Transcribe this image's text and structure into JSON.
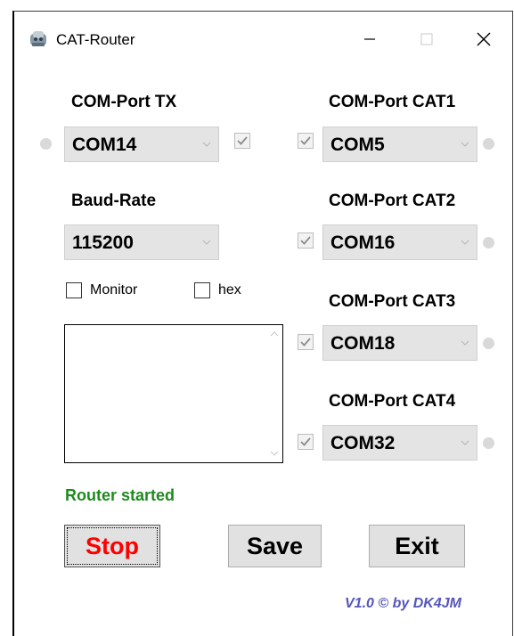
{
  "window": {
    "title": "CAT-Router",
    "controls": [
      "minimize-icon",
      "maximize-icon",
      "close-icon"
    ]
  },
  "tx": {
    "label": "COM-Port TX",
    "port": "COM14",
    "checked": true
  },
  "baud": {
    "label": "Baud-Rate",
    "value": "115200"
  },
  "options": {
    "monitor_label": "Monitor",
    "monitor_checked": false,
    "hex_label": "hex",
    "hex_checked": false
  },
  "cat": [
    {
      "label": "COM-Port CAT1",
      "port": "COM5",
      "checked": true
    },
    {
      "label": "COM-Port CAT2",
      "port": "COM16",
      "checked": true
    },
    {
      "label": "COM-Port CAT3",
      "port": "COM18",
      "checked": true
    },
    {
      "label": "COM-Port CAT4",
      "port": "COM32",
      "checked": true
    }
  ],
  "status": {
    "text": "Router started",
    "color": "#1e8a1e"
  },
  "buttons": {
    "stop": "Stop",
    "save": "Save",
    "exit": "Exit"
  },
  "version": "V1.0 © by DK4JM",
  "colors": {
    "stop_text": "#ff0000",
    "version_text": "#5555bb",
    "led_off": "#d9d9d9"
  }
}
